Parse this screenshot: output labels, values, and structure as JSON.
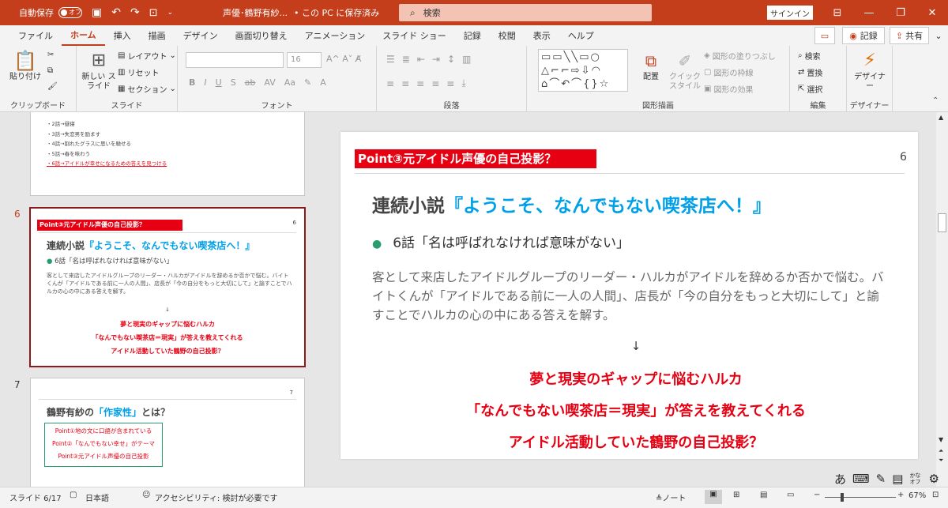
{
  "titlebar": {
    "autosave_label": "自動保存",
    "autosave_state": "オフ",
    "file_name": "声優･鶴野有紗...",
    "save_state": "• この PC に保存済み",
    "search_placeholder": "検索",
    "signin": "サインイン"
  },
  "tabs": [
    "ファイル",
    "ホーム",
    "挿入",
    "描画",
    "デザイン",
    "画面切り替え",
    "アニメーション",
    "スライド ショー",
    "記録",
    "校閲",
    "表示",
    "ヘルプ"
  ],
  "active_tab": "ホーム",
  "ribbon_right": {
    "record": "記録",
    "share": "共有"
  },
  "ribbon": {
    "clipboard": {
      "paste": "貼り付け",
      "label": "クリップボード"
    },
    "slides": {
      "new_slide": "新しい スライド",
      "layout": "レイアウト",
      "reset": "リセット",
      "section": "セクション",
      "label": "スライド"
    },
    "font": {
      "size": "16",
      "label": "フォント"
    },
    "paragraph": {
      "label": "段落"
    },
    "drawing": {
      "arrange": "配置",
      "quick_style": "クイック スタイル",
      "fill": "図形の塗りつぶし",
      "outline": "図形の枠線",
      "effect": "図形の効果",
      "label": "図形描画"
    },
    "editing": {
      "find": "検索",
      "replace": "置換",
      "select": "選択",
      "label": "編集"
    },
    "designer": {
      "name": "デザイナー",
      "label": "デザイナー"
    }
  },
  "thumbnails": [
    {
      "num": "",
      "lines": [
        "・2話→昼寝",
        "・3話→失恋男を励ます",
        "・4話→割れたグラスに思いを馳せる",
        "・5話→春を味わう"
      ],
      "red_line": "・6話→アイドルが幸せになるための答えを見つける"
    },
    {
      "num": "6",
      "header": "Point③元アイドル声優の自己投影？",
      "page": "6",
      "title_black": "連続小説",
      "title_blue": "『ようこそ、なんでもない喫茶店へ！』",
      "bullet": "6話「名は呼ばれなければ意味がない」",
      "body": "客として来店したアイドルグループのリーダー・ハルカがアイドルを辞めるか否かで悩む。バイトくんが「アイドルである前に一人の人間」、店長が「今の自分をもっと大切にして」と諭すことでハルカの心の中にある答えを解す。",
      "arrow": "↓",
      "red1": "夢と現実のギャップに悩むハルカ",
      "red2": "「なんでもない喫茶店＝現実」が答えを教えてくれる",
      "red3": "アイドル活動していた鶴野の自己投影？"
    },
    {
      "num": "7",
      "page": "7",
      "title_black": "鶴野有紗の",
      "title_blue": "「作家性」",
      "title_end": "とは？",
      "box": [
        "Point①地の文に口語が含まれている",
        "Point②「なんでもない幸せ」がテーマ",
        "Point③元アイドル声優の自己投影"
      ]
    }
  ],
  "slide": {
    "header": "Point③元アイドル声優の自己投影？",
    "page": "6",
    "title_black": "連続小説",
    "title_blue": "『ようこそ、なんでもない喫茶店へ！』",
    "bullet": "6話「名は呼ばれなければ意味がない」",
    "body": "客として来店したアイドルグループのリーダー・ハルカがアイドルを辞めるか否かで悩む。バイトくんが「アイドルである前に一人の人間」、店長が「今の自分をもっと大切にして」と諭すことでハルカの心の中にある答えを解す。",
    "arrow": "↓",
    "red1": "夢と現実のギャップに悩むハルカ",
    "red2": "「なんでもない喫茶店＝現実」が答えを教えてくれる",
    "red3": "アイドル活動していた鶴野の自己投影？"
  },
  "ime": {
    "a": "あ",
    "kana": "かな オフ"
  },
  "statusbar": {
    "slide_count": "スライド 6/17",
    "language": "日本語",
    "accessibility": "アクセシビリティ: 検討が必要です",
    "notes": "ノート",
    "zoom": "67%"
  },
  "colors": {
    "accent": "#c43e1c",
    "red": "#e60012",
    "blue": "#00a0e9"
  }
}
